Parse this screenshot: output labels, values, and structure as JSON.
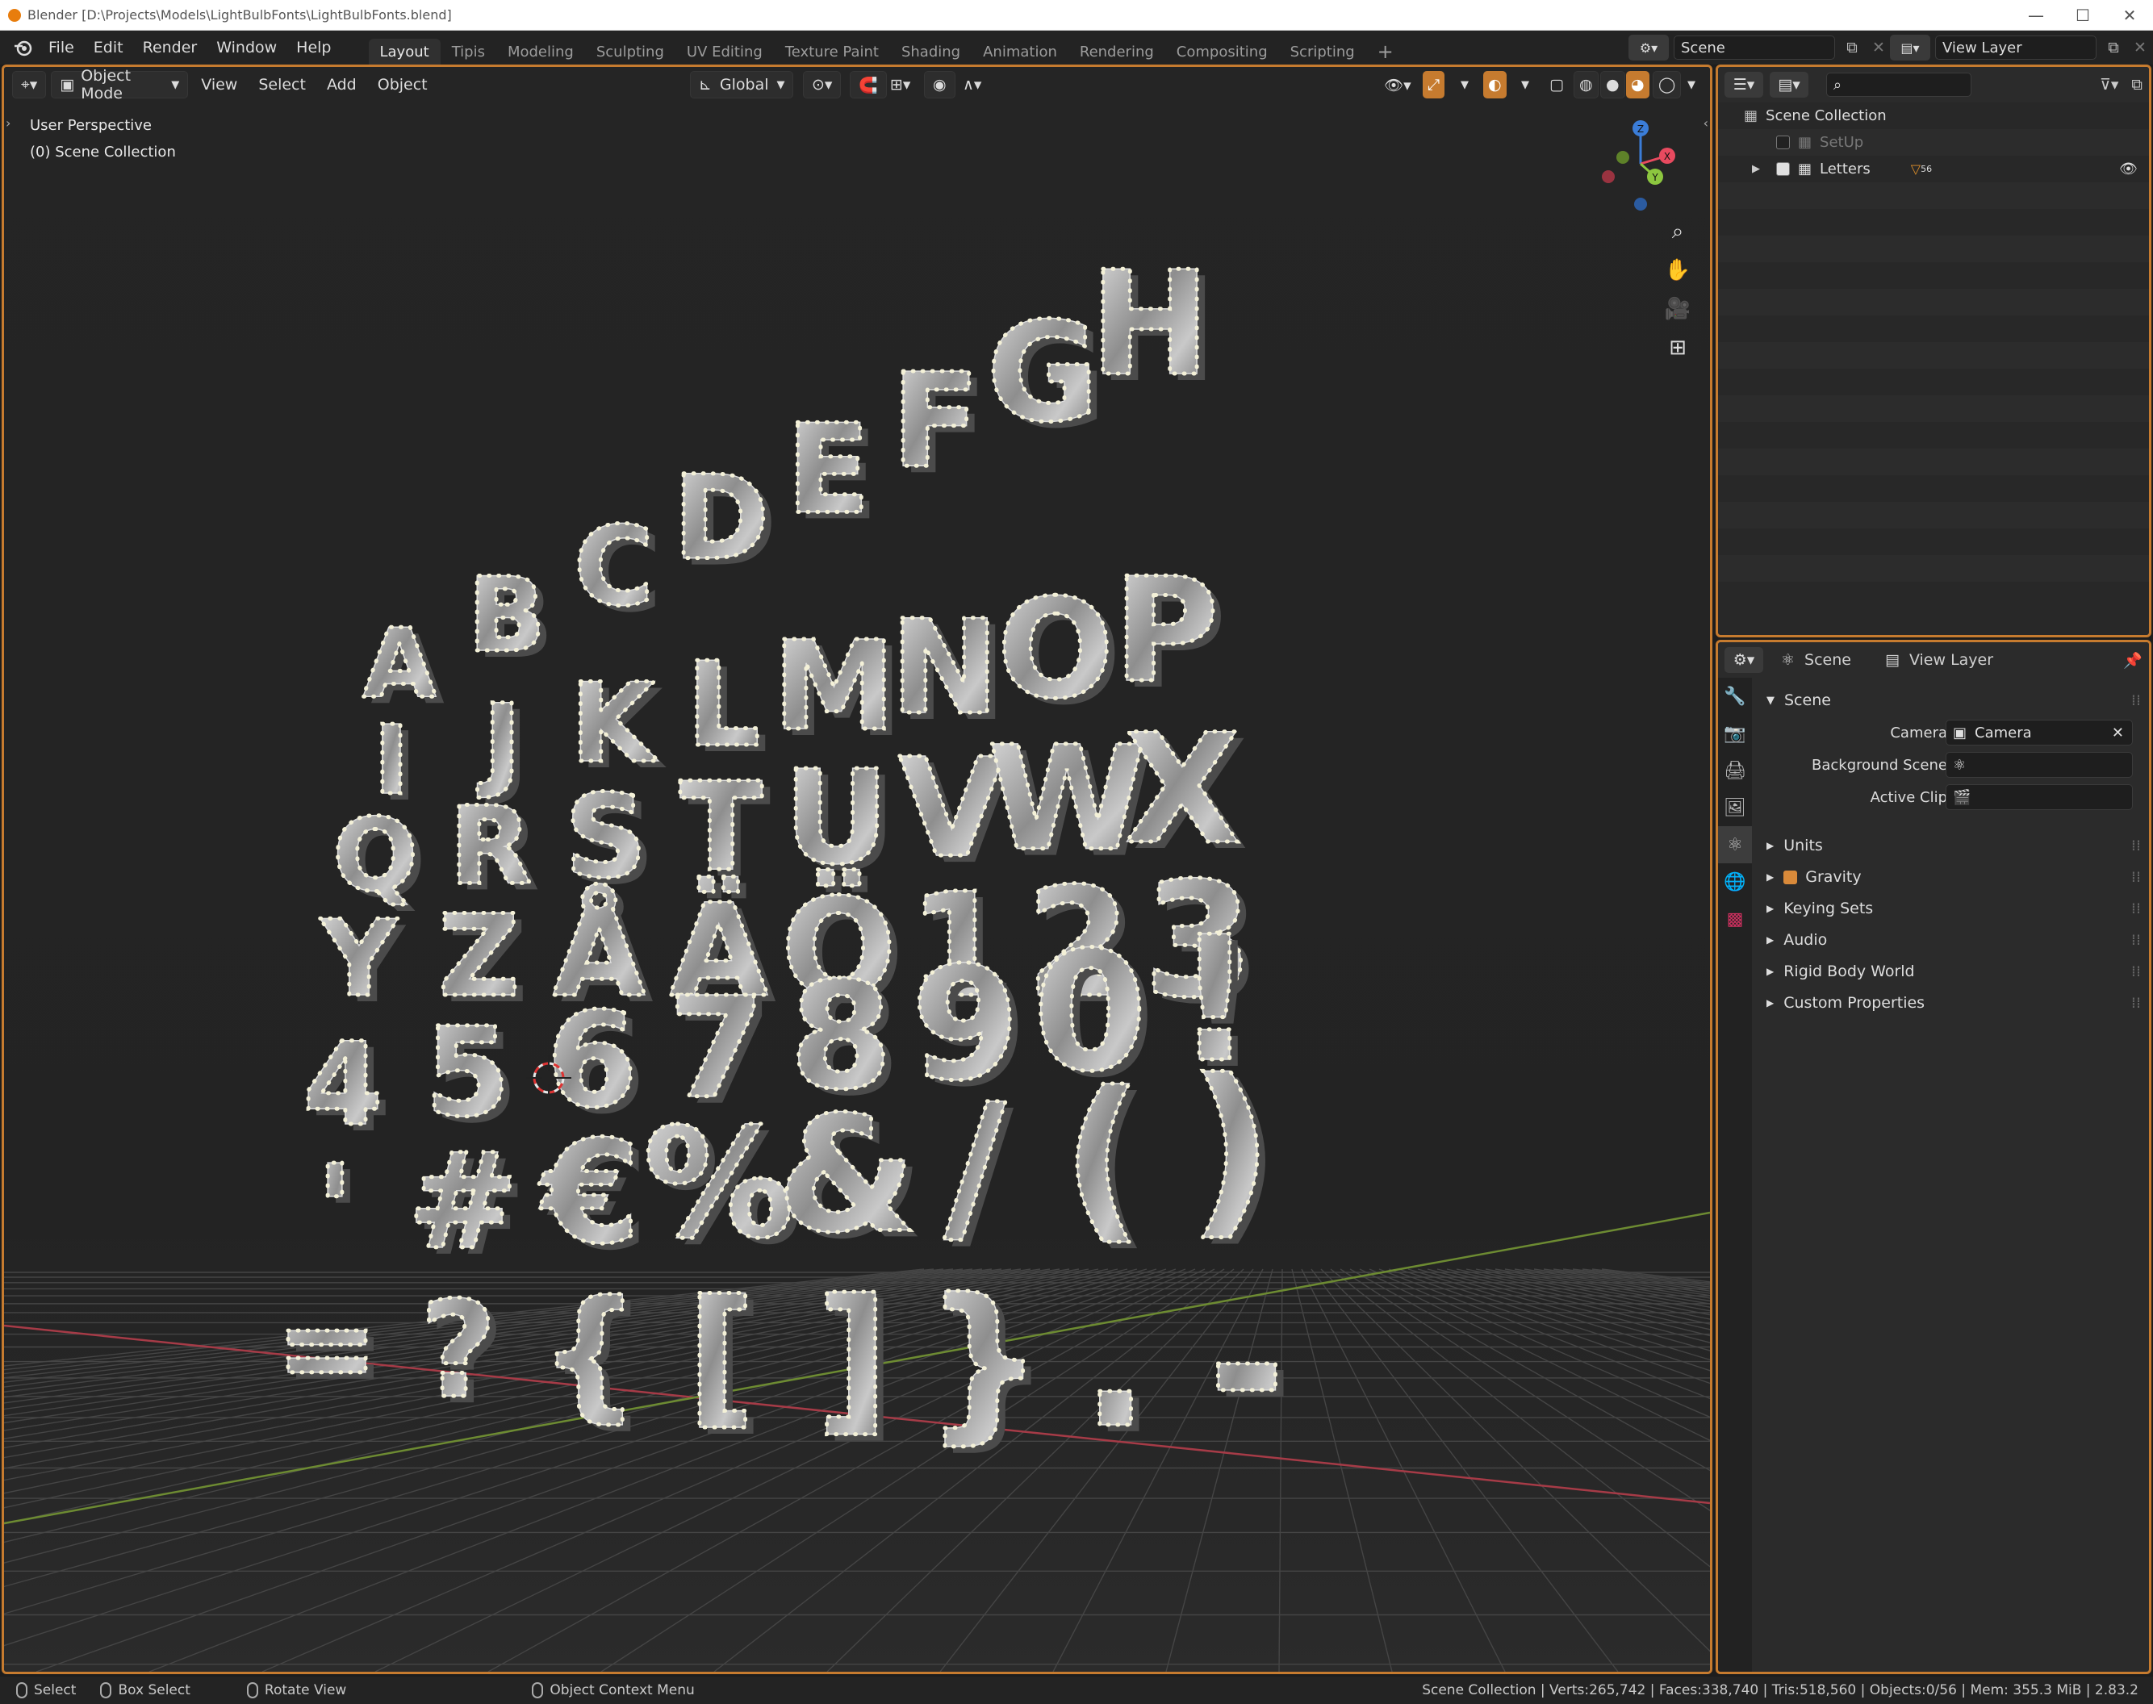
{
  "window": {
    "title": "Blender [D:\\Projects\\Models\\LightBulbFonts\\LightBulbFonts.blend]",
    "controls": [
      "—",
      "☐",
      "✕"
    ]
  },
  "menus": [
    "File",
    "Edit",
    "Render",
    "Window",
    "Help"
  ],
  "workspaces": [
    "Layout",
    "Tipis",
    "Modeling",
    "Sculpting",
    "UV Editing",
    "Texture Paint",
    "Shading",
    "Animation",
    "Rendering",
    "Compositing",
    "Scripting"
  ],
  "active_workspace": "Layout",
  "scene_selector": "Scene",
  "view_layer_selector": "View Layer",
  "viewport": {
    "mode": "Object Mode",
    "menus": [
      "View",
      "Select",
      "Add",
      "Object"
    ],
    "orientation": "Global",
    "overlay_line1": "User Perspective",
    "overlay_line2": "(0) Scene Collection",
    "gizmo": {
      "z": "Z",
      "x": "X",
      "y": "Y"
    }
  },
  "outliner": {
    "root": "Scene Collection",
    "items": [
      {
        "name": "SetUp",
        "checked": false
      },
      {
        "name": "Letters",
        "checked": true,
        "badge": "56"
      }
    ]
  },
  "properties": {
    "tabs": [
      "Scene",
      "View Layer"
    ],
    "panel_title": "Scene",
    "camera_label": "Camera",
    "camera_value": "Camera",
    "background_label": "Background Scene",
    "clip_label": "Active Clip",
    "sections": [
      "Units",
      "Gravity",
      "Keying Sets",
      "Audio",
      "Rigid Body World",
      "Custom Properties"
    ]
  },
  "scene_glyphs": [
    {
      "ch": "A"
    },
    {
      "ch": "B"
    },
    {
      "ch": "C"
    },
    {
      "ch": "D"
    },
    {
      "ch": "E"
    },
    {
      "ch": "F"
    },
    {
      "ch": "G"
    },
    {
      "ch": "H"
    },
    {
      "ch": "I"
    },
    {
      "ch": "J"
    },
    {
      "ch": "K"
    },
    {
      "ch": "L"
    },
    {
      "ch": "M"
    },
    {
      "ch": "N"
    },
    {
      "ch": "O"
    },
    {
      "ch": "P"
    },
    {
      "ch": "Q"
    },
    {
      "ch": "R"
    },
    {
      "ch": "S"
    },
    {
      "ch": "T"
    },
    {
      "ch": "U"
    },
    {
      "ch": "V"
    },
    {
      "ch": "W"
    },
    {
      "ch": "X"
    },
    {
      "ch": "Y"
    },
    {
      "ch": "Z"
    },
    {
      "ch": "Å"
    },
    {
      "ch": "Ä"
    },
    {
      "ch": "Ö"
    },
    {
      "ch": "1"
    },
    {
      "ch": "2"
    },
    {
      "ch": "3"
    },
    {
      "ch": "4"
    },
    {
      "ch": "5"
    },
    {
      "ch": "6"
    },
    {
      "ch": "7"
    },
    {
      "ch": "8"
    },
    {
      "ch": "9"
    },
    {
      "ch": "0"
    },
    {
      "ch": "!"
    },
    {
      "ch": "'"
    },
    {
      "ch": "#"
    },
    {
      "ch": "€"
    },
    {
      "ch": "%"
    },
    {
      "ch": "&"
    },
    {
      "ch": "/"
    },
    {
      "ch": "("
    },
    {
      "ch": ")"
    },
    {
      "ch": "="
    },
    {
      "ch": "?"
    },
    {
      "ch": "{"
    },
    {
      "ch": "["
    },
    {
      "ch": "]"
    },
    {
      "ch": "}"
    },
    {
      "ch": "."
    },
    {
      "ch": "-"
    }
  ],
  "status": {
    "select": "Select",
    "box_select": "Box Select",
    "rotate": "Rotate View",
    "context": "Object Context Menu",
    "stats": "Scene Collection | Verts:265,742 | Faces:338,740 | Tris:518,560 | Objects:0/56 | Mem: 355.3 MiB | 2.83.2"
  },
  "colors": {
    "accent": "#c67b2f",
    "x_axis": "#e84a5f",
    "y_axis": "#8cc63f",
    "z_axis": "#3b7dd8"
  }
}
